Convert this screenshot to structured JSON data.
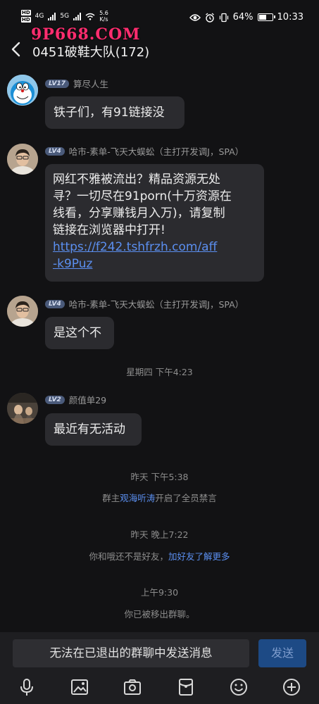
{
  "status_bar": {
    "hd1": "HD",
    "hd2": "HD",
    "net1": "4G",
    "net2": "5G",
    "speed_value": "5.6",
    "speed_unit": "K/s",
    "battery": "64%",
    "battery_level": 0.64,
    "time": "10:33"
  },
  "watermark": "9P668.COM",
  "header": {
    "title": "0451破鞋大队(172)"
  },
  "messages": [
    {
      "level": "LV17",
      "sender": "算尽人生",
      "text": "铁子们，有91链接没"
    },
    {
      "level": "LV4",
      "sender": "哈市-素单-飞天大蜈蚣（主打开发调J，SPA）",
      "text_lines": [
        "网红不雅被流出？精品资源无处",
        "寻？一切尽在91porn(十万资源在",
        "线看，分享赚钱月入万)，请复制",
        "链接在浏览器中打开!"
      ],
      "link_lines": [
        "https://f242.tshfrzh.com/aff",
        "-k9Puz"
      ]
    },
    {
      "level": "LV4",
      "sender": "哈市-素单-飞天大蜈蚣（主打开发调J，SPA）",
      "text": "是这个不"
    },
    {
      "level": "LV2",
      "sender": "颜值单29",
      "text": "最近有无活动"
    }
  ],
  "system": {
    "time1": "星期四 下午4:23",
    "time2": "昨天 下午5:38",
    "notice1_prefix": "群主",
    "notice1_name": "观海听涛",
    "notice1_suffix": "开启了全员禁言",
    "time3": "昨天 晚上7:22",
    "notice2_text": "你和哦还不是好友，",
    "notice2_link": "加好友了解更多",
    "time4": "上午9:30",
    "notice3": "你已被移出群聊。"
  },
  "composer": {
    "input_text": "无法在已退出的群聊中发送消息",
    "send_label": "发送"
  },
  "toolbar_icons": [
    "microphone-icon",
    "image-icon",
    "camera-icon",
    "red-packet-icon",
    "emoji-icon",
    "plus-icon"
  ],
  "colors": {
    "background": "#121214",
    "bubble": "#2b2b2f",
    "link": "#5b8ff0",
    "send_button": "#1d4a85",
    "watermark": "#ff2d6f"
  }
}
